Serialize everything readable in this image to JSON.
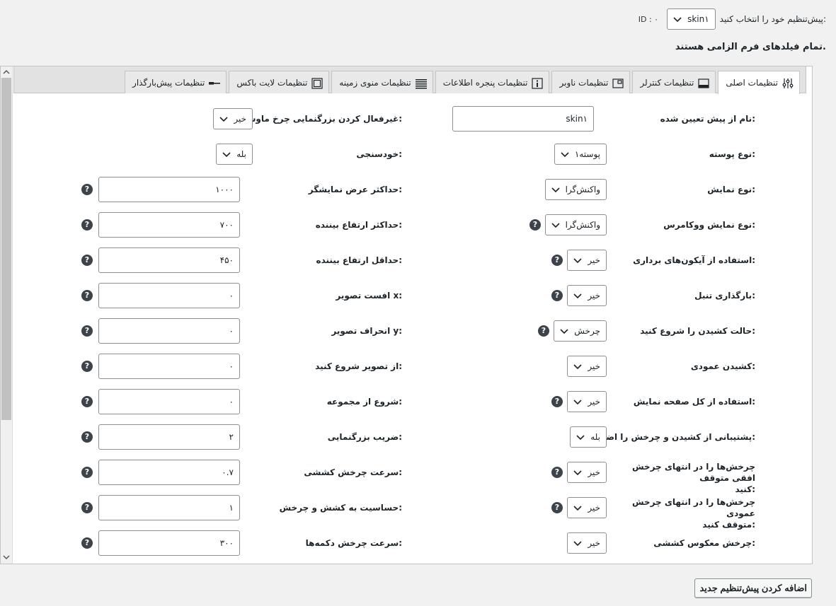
{
  "header": {
    "preset_label": "پیش‌تنظیم خود را انتخاب کنید:",
    "preset_value": "skin۱",
    "id_text": "ID : ۰",
    "required_note": "تمام فیلدهای فرم الزامی هستند."
  },
  "tabs": [
    {
      "label": "تنظیمات اصلی",
      "icon": "sliders-icon"
    },
    {
      "label": "تنظیمات کنترلر",
      "icon": "controller-icon"
    },
    {
      "label": "تنظیمات ناوبر",
      "icon": "navigator-icon"
    },
    {
      "label": "تنظیمات پنجره اطلاعات",
      "icon": "info-icon"
    },
    {
      "label": "تنظیمات منوی زمینه",
      "icon": "menu-lines-icon"
    },
    {
      "label": "تنظیمات لایت باکس",
      "icon": "lightbox-icon"
    },
    {
      "label": "تنظیمات پیش‌بارگذار",
      "icon": "preloader-icon"
    }
  ],
  "right_column": [
    {
      "label": "نام از پیش تعیین شده:",
      "type": "input",
      "value": "skin۱",
      "help": false
    },
    {
      "label": "نوع پوسته:",
      "type": "select",
      "value": "پوسته۱",
      "help": false
    },
    {
      "label": "نوع نمایش:",
      "type": "select",
      "value": "واکنش‌گرا",
      "help": false
    },
    {
      "label": "نوع نمایش ووکامرس:",
      "type": "select",
      "value": "واکنش‌گرا",
      "help": true
    },
    {
      "label": "استفاده از آیکون‌های برداری:",
      "type": "select",
      "value": "خیر",
      "help": true
    },
    {
      "label": "بارگذاری تنبل:",
      "type": "select",
      "value": "خیر",
      "help": true
    },
    {
      "label": "حالت کشیدن را شروع کنید:",
      "type": "select",
      "value": "چرخش",
      "help": true
    },
    {
      "label": "کشیدن عمودی:",
      "type": "select",
      "value": "خیر",
      "help": false
    },
    {
      "label": "استفاده از کل صفحه نمایش:",
      "type": "select",
      "value": "خیر",
      "help": true
    },
    {
      "label": "پشتیبانی از کشیدن و چرخش را اضافه کنید:",
      "type": "select",
      "value": "بله",
      "help": false
    },
    {
      "label_line1": "چرخش‌ها را در انتهای چرخش افقی متوقف",
      "label_line2": "کنید:",
      "type": "select",
      "value": "خیر",
      "help": true
    },
    {
      "label_line1": "چرخش‌ها را در انتهای چرخش عمودی",
      "label_line2": "متوقف کنید:",
      "type": "select",
      "value": "خیر",
      "help": true
    },
    {
      "label": "چرخش معکوس کششی:",
      "type": "select",
      "value": "خیر",
      "help": false
    }
  ],
  "left_column": [
    {
      "label": "غیرفعال کردن بزرگنمایی چرخ ماوس:",
      "type": "select",
      "value": "خیر",
      "help": false
    },
    {
      "label": "خودسنجی:",
      "type": "select",
      "value": "بله",
      "help": false
    },
    {
      "label": "حداکثر عرض نمایشگر:",
      "type": "input",
      "value": "۱۰۰۰",
      "help": true
    },
    {
      "label": "حداکثر ارتفاع بیننده:",
      "type": "input",
      "value": "۷۰۰",
      "help": true
    },
    {
      "label": "حداقل ارتفاع بیننده:",
      "type": "input",
      "value": "۴۵۰",
      "help": true
    },
    {
      "label": "افست تصویر x:",
      "type": "input",
      "value": "۰",
      "help": true
    },
    {
      "label": "انحراف تصویر y:",
      "type": "input",
      "value": "۰",
      "help": true
    },
    {
      "label": "از تصویر شروع کنید:",
      "type": "input",
      "value": "۰",
      "help": true
    },
    {
      "label": "شروع از مجموعه:",
      "type": "input",
      "value": "۰",
      "help": true
    },
    {
      "label": "ضریب بزرگنمایی:",
      "type": "input",
      "value": "۲",
      "help": true
    },
    {
      "label": "سرعت چرخش کششی:",
      "type": "input",
      "value": "۰.۷",
      "help": true
    },
    {
      "label": "حساسیت به کشش و چرخش:",
      "type": "input",
      "value": "۱",
      "help": true
    },
    {
      "label": "سرعت چرخش دکمه‌ها:",
      "type": "input",
      "value": "۳۰۰",
      "help": true
    }
  ],
  "help_glyph": "?",
  "add_button": "اضافه کردن پیش‌تنظیم جدید"
}
